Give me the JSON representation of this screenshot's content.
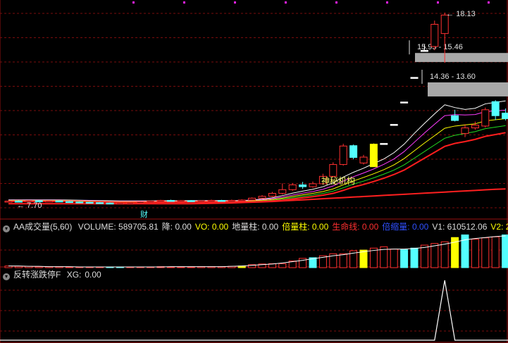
{
  "chart_data": [
    {
      "type": "candlestick",
      "panel": "price",
      "ylim": [
        7.2,
        18.7
      ],
      "price_labels": {
        "high": "18.13",
        "low": "7.70"
      },
      "resistance_zones": [
        {
          "label": "15.95 - 15.46",
          "low": 15.46,
          "high": 15.95
        },
        {
          "label": "14.36 - 13.60",
          "low": 13.6,
          "high": 14.36
        }
      ],
      "annotations": {
        "institution_text": "神秘机构",
        "finance_marker": "财"
      },
      "candles": [
        {
          "o": 7.9,
          "c": 7.94,
          "h": 7.97,
          "l": 7.86
        },
        {
          "o": 7.94,
          "c": 7.92,
          "h": 7.98,
          "l": 7.88
        },
        {
          "o": 7.92,
          "c": 7.96,
          "h": 7.99,
          "l": 7.89
        },
        {
          "o": 7.96,
          "c": 7.93,
          "h": 8.0,
          "l": 7.9
        },
        {
          "o": 7.93,
          "c": 7.95,
          "h": 7.98,
          "l": 7.9
        },
        {
          "o": 7.95,
          "c": 7.92,
          "h": 7.97,
          "l": 7.89
        },
        {
          "o": 7.92,
          "c": 7.9,
          "h": 7.95,
          "l": 7.86
        },
        {
          "o": 7.9,
          "c": 7.88,
          "h": 7.93,
          "l": 7.84
        },
        {
          "o": 7.88,
          "c": 7.86,
          "h": 7.91,
          "l": 7.82
        },
        {
          "o": 7.86,
          "c": 7.84,
          "h": 7.89,
          "l": 7.8
        },
        {
          "o": 7.84,
          "c": 7.82,
          "h": 7.87,
          "l": 7.78
        },
        {
          "o": 7.82,
          "c": 7.84,
          "h": 7.88,
          "l": 7.79
        },
        {
          "o": 7.84,
          "c": 7.86,
          "h": 7.9,
          "l": 7.81
        },
        {
          "o": 7.86,
          "c": 7.9,
          "h": 7.93,
          "l": 7.84
        },
        {
          "o": 7.9,
          "c": 7.94,
          "h": 7.97,
          "l": 7.88
        },
        {
          "o": 7.94,
          "c": 7.98,
          "h": 8.01,
          "l": 7.92
        },
        {
          "o": 7.98,
          "c": 7.95,
          "h": 8.02,
          "l": 7.92
        },
        {
          "o": 7.95,
          "c": 7.97,
          "h": 8.0,
          "l": 7.93
        },
        {
          "o": 7.97,
          "c": 7.94,
          "h": 8.0,
          "l": 7.9
        },
        {
          "o": 7.94,
          "c": 7.96,
          "h": 7.99,
          "l": 7.91
        },
        {
          "o": 7.96,
          "c": 7.98,
          "h": 8.02,
          "l": 7.93
        },
        {
          "o": 7.98,
          "c": 7.96,
          "h": 8.01,
          "l": 7.93
        },
        {
          "o": 7.96,
          "c": 7.98,
          "h": 8.02,
          "l": 7.94
        },
        {
          "o": 7.98,
          "c": 8.0,
          "h": 8.04,
          "l": 7.95
        },
        {
          "o": 8.0,
          "c": 8.1,
          "h": 8.14,
          "l": 7.98
        },
        {
          "o": 8.1,
          "c": 8.2,
          "h": 8.26,
          "l": 8.06
        },
        {
          "o": 8.2,
          "c": 8.36,
          "h": 8.44,
          "l": 8.16
        },
        {
          "o": 8.36,
          "c": 8.56,
          "h": 8.9,
          "l": 8.3
        },
        {
          "o": 8.56,
          "c": 8.82,
          "h": 8.92,
          "l": 8.5
        },
        {
          "o": 8.82,
          "c": 8.72,
          "h": 8.98,
          "l": 8.6
        },
        {
          "o": 8.72,
          "c": 8.88,
          "h": 9.0,
          "l": 8.66
        },
        {
          "o": 8.88,
          "c": 9.28,
          "h": 9.42,
          "l": 8.84
        },
        {
          "o": 9.28,
          "c": 9.92,
          "h": 10.04,
          "l": 9.22
        },
        {
          "o": 9.92,
          "c": 10.92,
          "h": 11.04,
          "l": 9.86
        },
        {
          "o": 10.94,
          "c": 10.3,
          "h": 11.0,
          "l": 10.2
        },
        {
          "o": 10.0,
          "c": 10.32,
          "h": 10.44,
          "l": 9.92
        },
        {
          "o": 9.8,
          "c": 11.02,
          "h": 11.06,
          "l": 9.8
        },
        {
          "o": 11.06,
          "c": 11.06,
          "h": 11.06,
          "l": 11.06
        },
        {
          "o": 12.09,
          "c": 12.09,
          "h": 12.09,
          "l": 12.09
        },
        {
          "o": 13.3,
          "c": 13.3,
          "h": 13.3,
          "l": 13.3
        },
        {
          "o": 14.63,
          "c": 14.63,
          "h": 14.63,
          "l": 14.63
        },
        {
          "o": 16.09,
          "c": 16.09,
          "h": 16.4,
          "l": 16.09
        },
        {
          "o": 16.3,
          "c": 17.5,
          "h": 17.7,
          "l": 16.1
        },
        {
          "o": 17.0,
          "c": 18.0,
          "h": 18.13,
          "l": 15.42
        },
        {
          "o": 12.56,
          "c": 12.3,
          "h": 12.88,
          "l": 12.25
        },
        {
          "o": 11.6,
          "c": 11.9,
          "h": 12.1,
          "l": 11.4
        },
        {
          "o": 11.9,
          "c": 12.05,
          "h": 12.24,
          "l": 11.8
        },
        {
          "o": 12.0,
          "c": 12.88,
          "h": 13.0,
          "l": 11.92
        },
        {
          "o": 13.32,
          "c": 12.56,
          "h": 13.4,
          "l": 12.32
        },
        {
          "o": 12.7,
          "c": 12.4,
          "h": 12.95,
          "l": 12.3
        }
      ],
      "lines": [
        {
          "name": "white",
          "color": "#ffffff",
          "values": [
            8.01,
            8.01,
            8.01,
            8.01,
            8.01,
            8.01,
            8.0,
            7.99,
            7.98,
            7.97,
            7.96,
            7.95,
            7.95,
            7.95,
            7.95,
            7.96,
            7.96,
            7.96,
            7.97,
            7.97,
            7.97,
            7.97,
            7.97,
            7.97,
            8.0,
            8.05,
            8.12,
            8.24,
            8.37,
            8.48,
            8.58,
            8.72,
            8.93,
            9.24,
            9.5,
            9.72,
            9.97,
            10.22,
            10.56,
            11.02,
            11.6,
            12.14,
            12.66,
            13.15,
            13.0,
            12.9,
            12.96,
            13.2,
            13.28,
            13.36
          ]
        },
        {
          "name": "magenta",
          "color": "#ff3cff",
          "values": [
            7.99,
            7.99,
            7.99,
            7.99,
            7.99,
            7.99,
            7.98,
            7.97,
            7.96,
            7.95,
            7.94,
            7.93,
            7.93,
            7.93,
            7.93,
            7.94,
            7.94,
            7.94,
            7.95,
            7.95,
            7.95,
            7.95,
            7.95,
            7.95,
            7.97,
            8.01,
            8.07,
            8.16,
            8.27,
            8.37,
            8.46,
            8.58,
            8.76,
            9.02,
            9.26,
            9.46,
            9.68,
            9.93,
            10.22,
            10.62,
            11.12,
            11.62,
            12.1,
            12.56,
            12.62,
            12.6,
            12.62,
            12.78,
            12.82,
            12.86
          ]
        },
        {
          "name": "yellow",
          "color": "#ffff00",
          "values": [
            7.97,
            7.97,
            7.97,
            7.97,
            7.97,
            7.97,
            7.96,
            7.95,
            7.94,
            7.93,
            7.92,
            7.91,
            7.91,
            7.91,
            7.91,
            7.92,
            7.92,
            7.92,
            7.93,
            7.93,
            7.93,
            7.93,
            7.93,
            7.93,
            7.95,
            7.98,
            8.03,
            8.1,
            8.19,
            8.28,
            8.36,
            8.46,
            8.6,
            8.82,
            9.03,
            9.22,
            9.42,
            9.64,
            9.9,
            10.24,
            10.66,
            11.08,
            11.48,
            11.88,
            12.0,
            12.06,
            12.12,
            12.28,
            12.34,
            12.4
          ]
        },
        {
          "name": "green",
          "color": "#22dd22",
          "values": [
            7.95,
            7.95,
            7.95,
            7.95,
            7.95,
            7.95,
            7.94,
            7.93,
            7.92,
            7.91,
            7.9,
            7.89,
            7.89,
            7.89,
            7.89,
            7.9,
            7.9,
            7.9,
            7.91,
            7.91,
            7.91,
            7.91,
            7.91,
            7.91,
            7.93,
            7.95,
            7.99,
            8.05,
            8.12,
            8.2,
            8.27,
            8.36,
            8.48,
            8.66,
            8.86,
            9.02,
            9.2,
            9.4,
            9.62,
            9.9,
            10.26,
            10.62,
            10.98,
            11.34,
            11.5,
            11.6,
            11.7,
            11.86,
            11.94,
            12.02
          ]
        },
        {
          "name": "red",
          "color": "#ff1e1e",
          "values": [
            7.93,
            7.93,
            7.93,
            7.93,
            7.93,
            7.93,
            7.92,
            7.91,
            7.9,
            7.89,
            7.88,
            7.87,
            7.87,
            7.87,
            7.87,
            7.88,
            7.88,
            7.88,
            7.89,
            7.89,
            7.89,
            7.89,
            7.89,
            7.89,
            7.9,
            7.92,
            7.95,
            7.99,
            8.05,
            8.12,
            8.18,
            8.26,
            8.36,
            8.52,
            8.7,
            8.84,
            9.0,
            9.18,
            9.38,
            9.62,
            9.94,
            10.26,
            10.58,
            10.9,
            11.06,
            11.16,
            11.28,
            11.44,
            11.54,
            11.64
          ]
        },
        {
          "name": "longterm",
          "color": "#ff2020",
          "values": [
            7.8,
            7.8,
            7.8,
            7.8,
            7.8,
            7.8,
            7.8,
            7.8,
            7.8,
            7.8,
            7.8,
            7.8,
            7.8,
            7.8,
            7.8,
            7.8,
            7.8,
            7.8,
            7.8,
            7.81,
            7.82,
            7.83,
            7.84,
            7.86,
            7.88,
            7.9,
            7.92,
            7.95,
            7.98,
            8.01,
            8.04,
            8.07,
            8.1,
            8.13,
            8.16,
            8.19,
            8.22,
            8.25,
            8.28,
            8.31,
            8.34,
            8.37,
            8.4,
            8.43,
            8.46,
            8.49,
            8.52,
            8.55,
            8.58,
            8.6
          ]
        }
      ]
    },
    {
      "type": "bar",
      "panel": "volume",
      "title": "AA成交量(5,60)",
      "indicators": [
        {
          "label": "VOLUME:",
          "value": "589705.81",
          "color": "#dddddd"
        },
        {
          "label": "降:",
          "value": "0.00",
          "color": "#dddddd"
        },
        {
          "label": "VO:",
          "value": "0.00",
          "color": "#ffff00"
        },
        {
          "label": "地量柱:",
          "value": "0.00",
          "color": "#dddddd"
        },
        {
          "label": "倍量柱:",
          "value": "0.00",
          "color": "#ffff00"
        },
        {
          "label": "生命线:",
          "value": "0.00",
          "color": "#ff3030"
        },
        {
          "label": "倍缩量:",
          "value": "0.00",
          "color": "#3050ff"
        },
        {
          "label": "V1:",
          "value": "610512.06",
          "color": "#dddddd"
        },
        {
          "label": "V2:",
          "value": "2",
          "color": "#ffff00"
        }
      ],
      "volume_kinds": [
        "r",
        "r",
        "r",
        "r",
        "r",
        "r",
        "r",
        "r",
        "r",
        "r",
        "c",
        "c",
        "r",
        "r",
        "r",
        "r",
        "r",
        "r",
        "r",
        "r",
        "r",
        "r",
        "r",
        "y",
        "r",
        "r",
        "r",
        "r",
        "r",
        "r",
        "c",
        "r",
        "r",
        "r",
        "r",
        "y",
        "r",
        "r",
        "r",
        "c",
        "c",
        "r",
        "r",
        "r",
        "y",
        "c",
        "r",
        "r",
        "r",
        "c"
      ],
      "volume_values": [
        0.05,
        0.04,
        0.04,
        0.03,
        0.03,
        0.03,
        0.02,
        0.02,
        0.02,
        0.02,
        0.02,
        0.02,
        0.02,
        0.02,
        0.02,
        0.03,
        0.02,
        0.02,
        0.02,
        0.03,
        0.03,
        0.03,
        0.04,
        0.05,
        0.09,
        0.11,
        0.12,
        0.12,
        0.2,
        0.28,
        0.3,
        0.36,
        0.42,
        0.42,
        0.51,
        0.53,
        0.59,
        0.63,
        0.56,
        0.54,
        0.59,
        0.68,
        0.73,
        0.78,
        0.91,
        0.99,
        0.86,
        0.9,
        0.93,
        0.99
      ],
      "ma": [
        0.05,
        0.05,
        0.04,
        0.04,
        0.03,
        0.03,
        0.03,
        0.02,
        0.02,
        0.02,
        0.02,
        0.02,
        0.02,
        0.02,
        0.02,
        0.02,
        0.03,
        0.03,
        0.03,
        0.03,
        0.03,
        0.03,
        0.04,
        0.05,
        0.07,
        0.09,
        0.11,
        0.14,
        0.18,
        0.22,
        0.27,
        0.31,
        0.36,
        0.39,
        0.44,
        0.48,
        0.52,
        0.55,
        0.56,
        0.56,
        0.58,
        0.61,
        0.66,
        0.71,
        0.77,
        0.84,
        0.88,
        0.91,
        0.94,
        0.96
      ],
      "ylim": [
        0,
        1.0
      ]
    },
    {
      "type": "line",
      "panel": "signal",
      "title": "反转涨跌停F",
      "label": "XG:",
      "value": "0.00",
      "values": [
        0,
        0,
        0,
        0,
        0,
        0,
        0,
        0,
        0,
        0,
        0,
        0,
        0,
        0,
        0,
        0,
        0,
        0,
        0,
        0,
        0,
        0,
        0,
        0,
        0,
        0,
        0,
        0,
        0,
        0,
        0,
        0,
        0,
        0,
        0,
        0,
        0,
        0,
        0,
        0,
        0,
        0,
        0,
        1,
        0,
        0,
        0,
        0,
        0,
        0
      ],
      "ylim": [
        0,
        1.0
      ]
    }
  ]
}
